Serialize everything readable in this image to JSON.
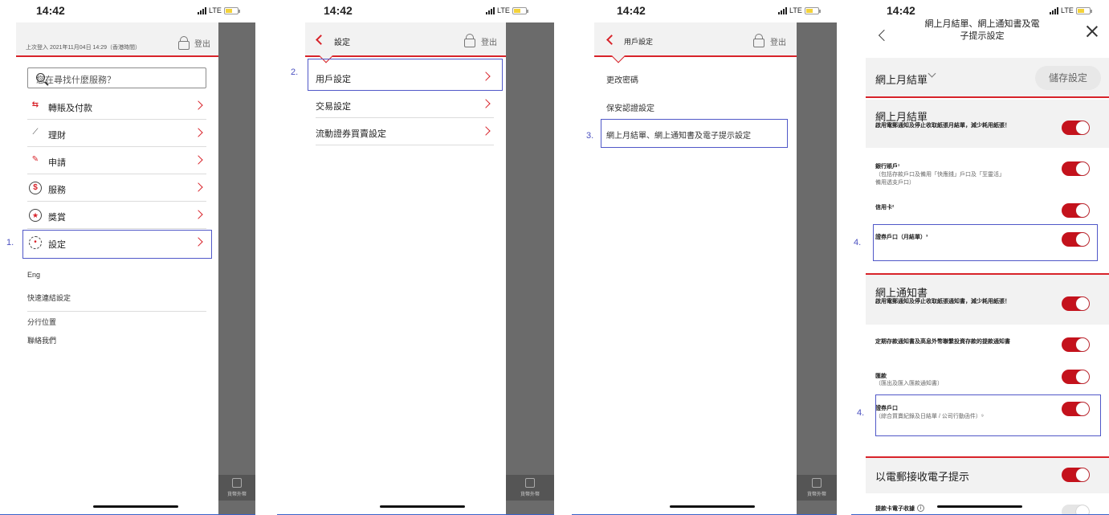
{
  "status": {
    "time": "14:42",
    "network": "LTE"
  },
  "screen1": {
    "last_login": "上次登入 2021年11月04日 14:29（香港時間）",
    "logout": "登出",
    "search_placeholder": "您在尋找什麼服務？",
    "menu": [
      {
        "label": "轉賬及付款",
        "icon": "transfer-icon",
        "glyph": "⇆"
      },
      {
        "label": "理財",
        "icon": "chart-icon",
        "glyph": "⟋"
      },
      {
        "label": "申請",
        "icon": "form-pen-icon",
        "glyph": "✎"
      },
      {
        "label": "服務",
        "icon": "dollar-icon",
        "glyph": "$"
      },
      {
        "label": "獎賞",
        "icon": "star-icon",
        "glyph": "★"
      },
      {
        "label": "設定",
        "icon": "gear-icon",
        "glyph": "•"
      }
    ],
    "links": {
      "lang": "Eng",
      "quick_link": "快速連結設定",
      "branch": "分行位置",
      "contact": "聯絡我們"
    },
    "step": "1.",
    "fx_tile": "貨幣外幣"
  },
  "screen2": {
    "title": "設定",
    "logout": "登出",
    "items": [
      "用戶設定",
      "交易設定",
      "流動證券買賣設定"
    ],
    "step": "2.",
    "fx_tile": "貨幣外幣"
  },
  "screen3": {
    "title": "用戶設定",
    "logout": "登出",
    "items": [
      "更改密碼",
      "保安認證設定",
      "網上月結單、網上通知書及電子提示設定"
    ],
    "step": "3.",
    "fx_tile": "貨幣外幣"
  },
  "screen4": {
    "title_line1": "網上月結單、網上通知書及電",
    "title_line2": "子提示設定",
    "dropdown": "網上月結單",
    "save": "儲存設定",
    "sec1_title": "網上月結單",
    "sec1_desc": "啟用電郵通知及停止收取紙張月結單，減少耗用紙張！",
    "bank_account": "銀行賬戶¹",
    "bank_note": "（包括存款戶口及備用「快應錢」戶口及「至靈活」備用透支戶口）",
    "credit_card": "信用卡²",
    "securities_monthly": "證券戶口（月結單）³",
    "sec2_title": "網上通知書",
    "sec2_desc": "啟用電郵通知及停止收取紙張通知書，減少耗用紙張！",
    "time_deposit": "定期存款通知書及高息外幣聯繫投資存款的提款通知書",
    "remittance": "匯款",
    "remittance_note": "（匯出及匯入匯款通知書）",
    "securities": "證券戶口",
    "securities_note": "（綜合買賣紀錄及日結單 / 公司行動函件）⁹",
    "email_alerts": "以電郵接收電子提示",
    "card_receipt": "提款卡電子收據",
    "step": "4.",
    "toggles": {
      "sec1": true,
      "bank": true,
      "credit": true,
      "sec_monthly": true,
      "sec2": true,
      "time_deposit": true,
      "remittance": true,
      "securities": true,
      "email": true,
      "card_receipt": false
    }
  }
}
